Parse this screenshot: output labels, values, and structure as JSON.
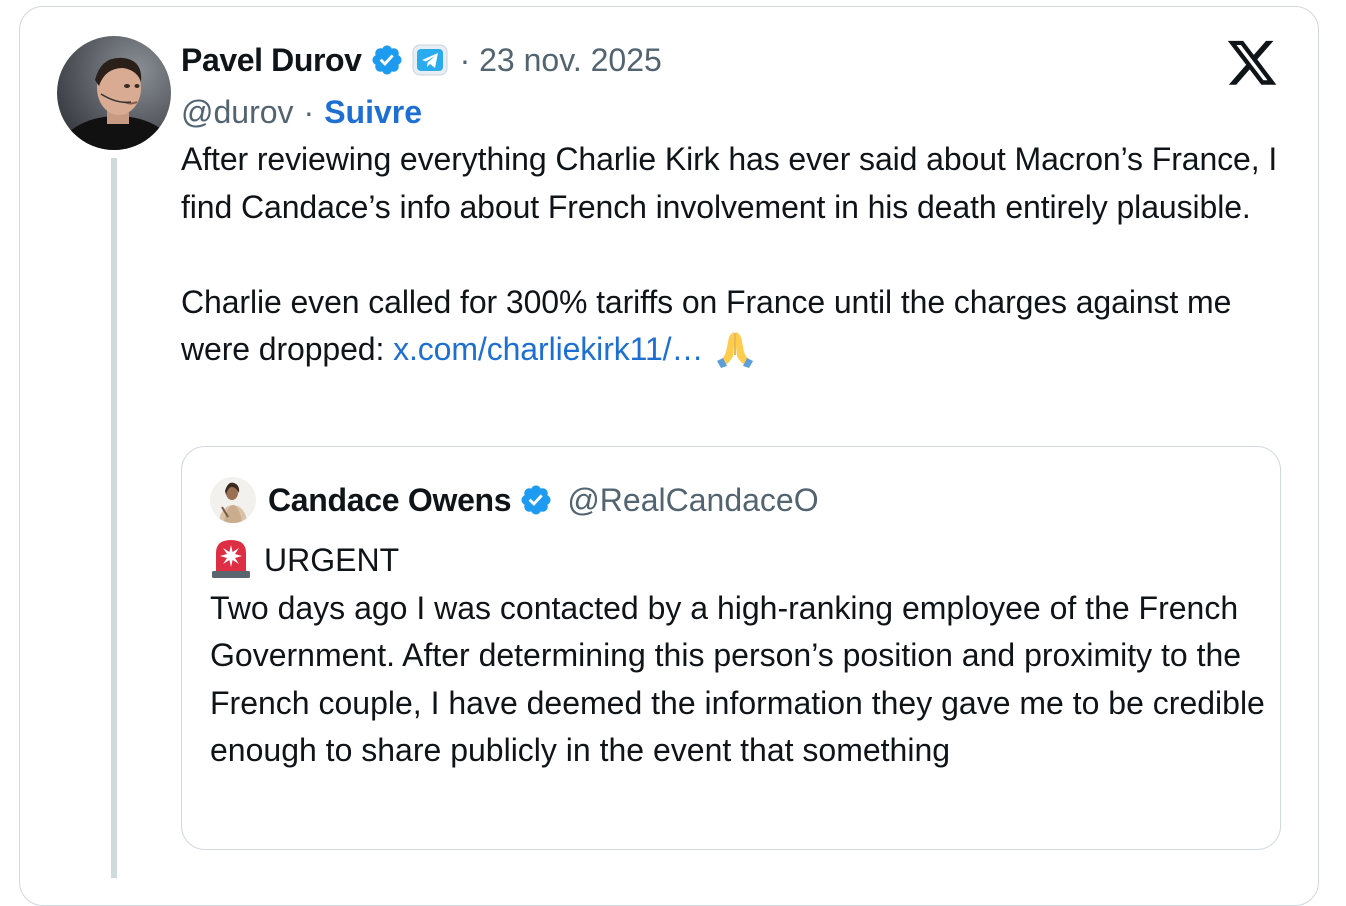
{
  "tweet": {
    "author_name": "Pavel Durov",
    "date": "· 23 nov. 2025",
    "handle": "@durov",
    "separator": "·",
    "follow_label": "Suivre",
    "paragraph1": "After reviewing everything Charlie Kirk has ever said about Macron’s France, I find Candace’s info about French involvement in his death entirely plausible.",
    "paragraph2_text": "Charlie even called for 300% tariffs on France until the charges against me were dropped: ",
    "paragraph2_link": "x.com/charliekirk11/…",
    "emoji": "pray-emoji",
    "platform_logo": "x-logo-icon"
  },
  "quoted_tweet": {
    "author_name": "Candace Owens",
    "handle": "@RealCandaceO",
    "headline": "URGENT",
    "text": "Two days ago I was contacted by a high-ranking employee of the French Government. After determining this person’s position and proximity to the French couple, I have deemed the information they gave me to be credible enough to share publicly in the event that something"
  },
  "colors": {
    "verified_blue": "#1d9bf0",
    "link_blue": "#1d6fd1",
    "secondary_text": "#536471",
    "border": "#cfd9de",
    "telegram_blue": "#2aabee"
  }
}
